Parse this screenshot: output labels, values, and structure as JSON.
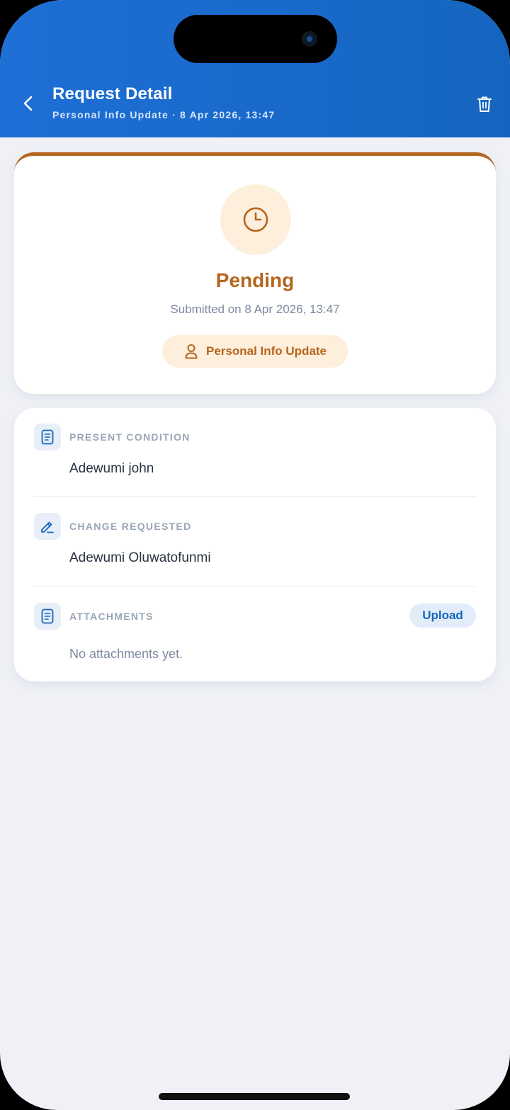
{
  "header": {
    "title": "Request Detail",
    "subtitle": "Personal Info Update · 8 Apr 2026, 13:47",
    "back_icon": "chevron-left-icon",
    "delete_icon": "trash-icon"
  },
  "status": {
    "icon": "clock-icon",
    "label": "Pending",
    "submitted": "Submitted on 8 Apr 2026, 13:47",
    "type_icon": "user-icon",
    "type_label": "Personal Info Update"
  },
  "details": {
    "present": {
      "icon": "document-icon",
      "label": "PRESENT CONDITION",
      "value": "Adewumi john"
    },
    "requested": {
      "icon": "pencil-icon",
      "label": "CHANGE REQUESTED",
      "value": "Adewumi Oluwatofunmi"
    },
    "attachments": {
      "icon": "document-icon",
      "label": "ATTACHMENTS",
      "upload_label": "Upload",
      "empty_text": "No attachments yet."
    }
  },
  "colors": {
    "header": "#1565c0",
    "pending": "#b5651d",
    "pending_bg": "#fdefdb",
    "background": "#eff1f6"
  }
}
